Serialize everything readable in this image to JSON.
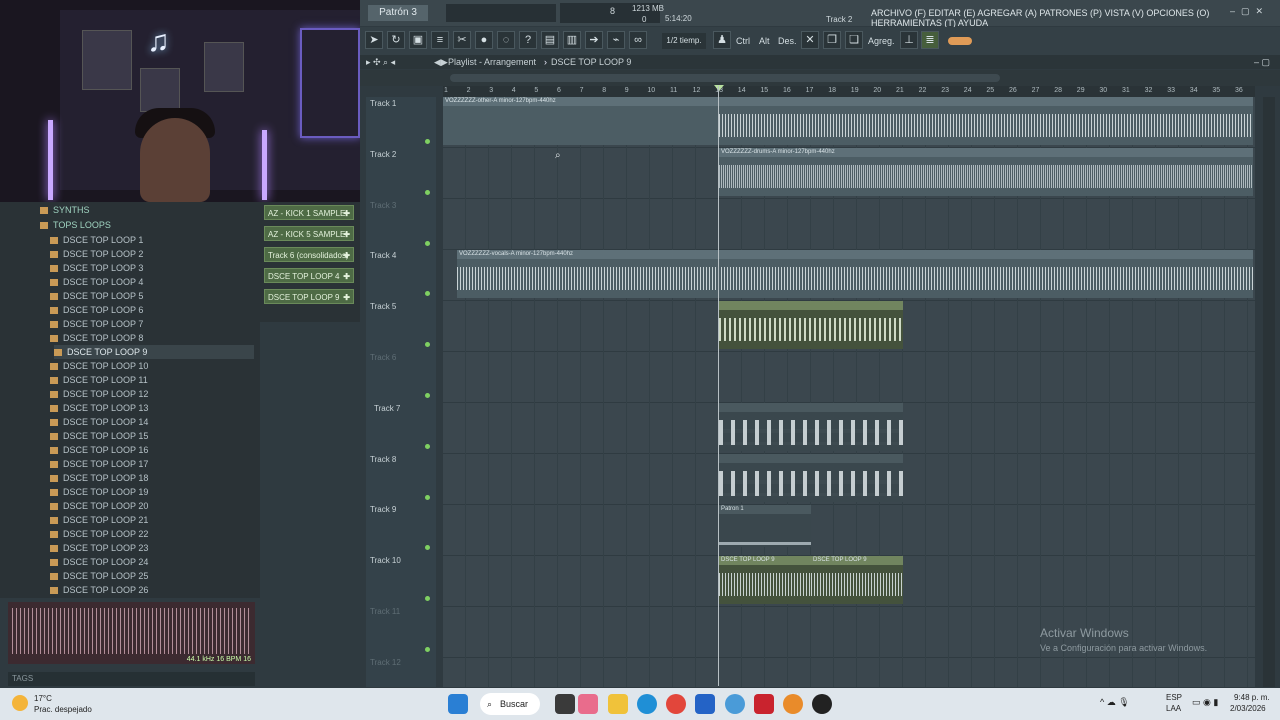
{
  "topbar": {
    "pattern": "Patrón 3",
    "memory": "1213 MB",
    "memory_sub": "0",
    "cpu": "8",
    "time": "5:14:20",
    "track_hint": "Track 2",
    "menu": "ARCHIVO (F) EDITAR (E) AGREGAR (A) PATRONES (P) VISTA (V) OPCIONES (O) HERRAMIENTAS (T) AYUDA"
  },
  "toolbar": {
    "snap": "1/2 tiemp.",
    "ctrl": "Ctrl",
    "alt": "Alt",
    "des": "Des.",
    "agreg": "Agreg."
  },
  "playlist": {
    "title": "Playlist - Arrangement",
    "pattern": "DSCE TOP LOOP 9"
  },
  "browser": {
    "folders": [
      "SYNTHS",
      "TOPS LOOPS"
    ],
    "items": [
      "DSCE TOP LOOP 1",
      "DSCE TOP LOOP 2",
      "DSCE TOP LOOP 3",
      "DSCE TOP LOOP 4",
      "DSCE TOP LOOP 5",
      "DSCE TOP LOOP 6",
      "DSCE TOP LOOP 7",
      "DSCE TOP LOOP 8",
      "DSCE TOP LOOP 9",
      "DSCE TOP LOOP 10",
      "DSCE TOP LOOP 11",
      "DSCE TOP LOOP 12",
      "DSCE TOP LOOP 13",
      "DSCE TOP LOOP 14",
      "DSCE TOP LOOP 15",
      "DSCE TOP LOOP 16",
      "DSCE TOP LOOP 17",
      "DSCE TOP LOOP 18",
      "DSCE TOP LOOP 19",
      "DSCE TOP LOOP 20",
      "DSCE TOP LOOP 21",
      "DSCE TOP LOOP 22",
      "DSCE TOP LOOP 23",
      "DSCE TOP LOOP 24",
      "DSCE TOP LOOP 25",
      "DSCE TOP LOOP 26"
    ],
    "wave_info": "44.1 kHz 16 BPM 16",
    "tags": "TAGS"
  },
  "channels": [
    "AZ - KICK 1 SAMPLE",
    "AZ - KICK 5 SAMPLE",
    "Track 6 (consolidados)",
    "DSCE TOP LOOP 4",
    "DSCE TOP LOOP 9"
  ],
  "ruler": [
    "1",
    "2",
    "3",
    "4",
    "5",
    "6",
    "7",
    "8",
    "9",
    "10",
    "11",
    "12",
    "13",
    "14",
    "15",
    "16",
    "17",
    "18",
    "19",
    "20",
    "21",
    "22",
    "23",
    "24",
    "25",
    "26",
    "27",
    "28",
    "29",
    "30",
    "31",
    "32",
    "33",
    "34",
    "35",
    "36"
  ],
  "tracks": [
    "Track 1",
    "Track 2",
    "Track 3",
    "Track 4",
    "Track 5",
    "Track 6",
    "Track 7",
    "Track 8",
    "Track 9",
    "Track 10",
    "Track 11",
    "Track 12"
  ],
  "clips": {
    "other": "VOZZZZZZ-other-A minor-127bpm-440hz",
    "drums": "VOZZZZZZ-drums-A minor-127bpm-440hz",
    "vocals": "VOZZZZZZ-vocals-A minor-127bpm-440hz",
    "patron": "Patron 1",
    "loop_a": "DSCE TOP LOOP 9",
    "loop_b": "DSCE TOP LOOP 9"
  },
  "watermark": {
    "title": "Activar Windows",
    "sub": "Ve a Configuración para activar Windows."
  },
  "taskbar": {
    "temp": "17°C",
    "weather": "Prac. despejado",
    "search": "Buscar",
    "lang1": "ESP",
    "lang2": "LAA",
    "time": "9:48 p. m.",
    "date": "2/03/2026"
  }
}
